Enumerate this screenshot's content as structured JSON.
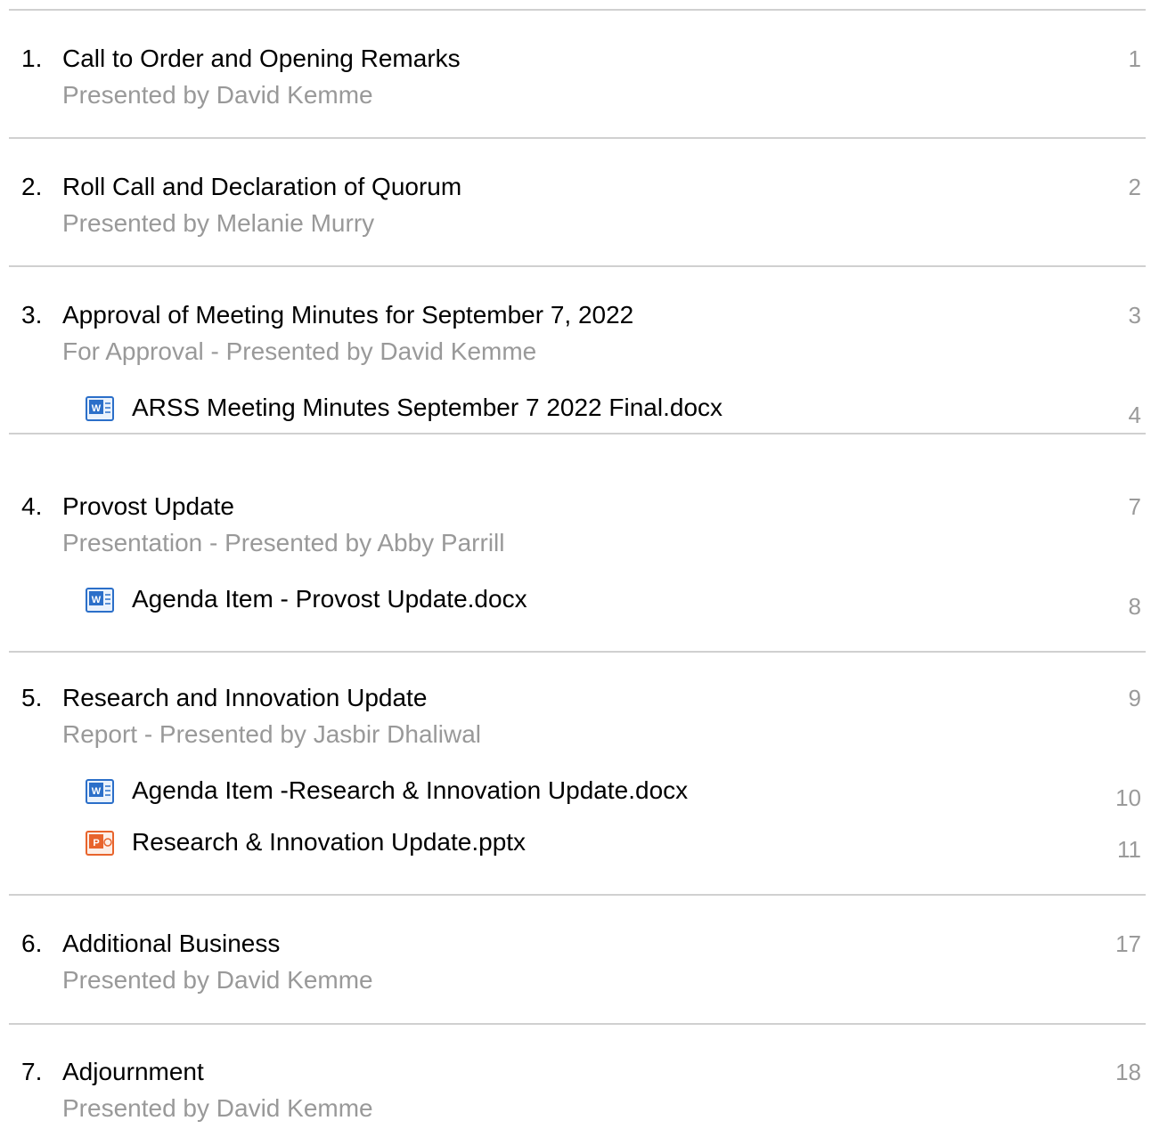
{
  "items": [
    {
      "number": "1.",
      "title": "Call to Order and Opening Remarks",
      "subtitle": "Presented by David Kemme",
      "page": "1",
      "attachments": []
    },
    {
      "number": "2.",
      "title": "Roll Call and Declaration of Quorum",
      "subtitle": "Presented by Melanie Murry",
      "page": "2",
      "attachments": []
    },
    {
      "number": "3.",
      "title": "Approval of Meeting Minutes for September 7, 2022",
      "subtitle": "For Approval - Presented by David Kemme",
      "page": "3",
      "attachments": [
        {
          "name": "ARSS Meeting Minutes September 7 2022 Final.docx",
          "type": "word-doc-icon",
          "page": "4"
        }
      ]
    },
    {
      "number": "4.",
      "title": "Provost Update",
      "subtitle": "Presentation - Presented by Abby Parrill",
      "page": "7",
      "attachments": [
        {
          "name": "Agenda Item - Provost Update.docx",
          "type": "word-doc-icon",
          "page": "8"
        }
      ]
    },
    {
      "number": "5.",
      "title": "Research and Innovation Update",
      "subtitle": "Report - Presented by Jasbir Dhaliwal",
      "page": "9",
      "attachments": [
        {
          "name": "Agenda Item -Research & Innovation Update.docx",
          "type": "word-doc-icon",
          "page": "10"
        },
        {
          "name": "Research & Innovation Update.pptx",
          "type": "powerpoint-icon",
          "page": "11"
        }
      ]
    },
    {
      "number": "6.",
      "title": "Additional Business",
      "subtitle": "Presented by David Kemme",
      "page": "17",
      "attachments": []
    },
    {
      "number": "7.",
      "title": "Adjournment",
      "subtitle": "Presented by David Kemme",
      "page": "18",
      "attachments": []
    }
  ],
  "colors": {
    "text": "#000000",
    "muted": "#999999",
    "rule": "#d0d0d0",
    "word_blue": "#2b6fc9",
    "ppt_orange": "#e8642c"
  }
}
